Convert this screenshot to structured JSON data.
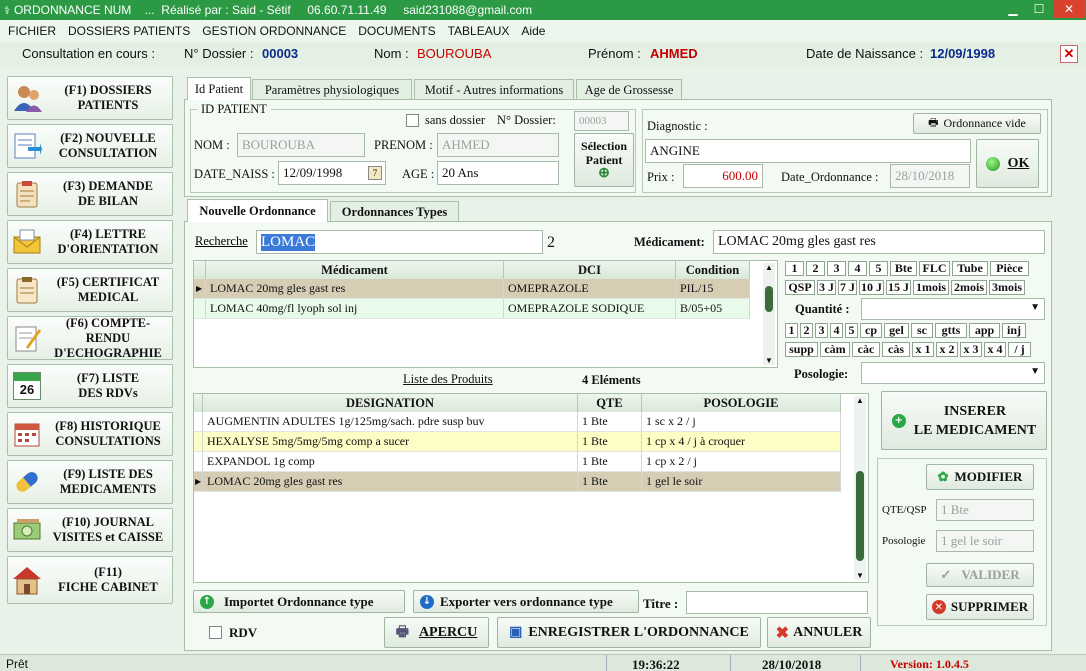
{
  "window": {
    "title": "ORDONNANCE NUM    ...  Réalisé par : Said - Sétif     06.60.71.11.49     said231088@gmail.com"
  },
  "menu": [
    "FICHIER",
    "DOSSIERS PATIENTS",
    "GESTION ORDONNANCE",
    "DOCUMENTS",
    "TABLEAUX",
    "Aide"
  ],
  "infobar": {
    "consultation_label": "Consultation en cours :",
    "dossier_label": "N° Dossier :",
    "dossier_value": "00003",
    "nom_label": "Nom :",
    "nom_value": "BOUROUBA",
    "prenom_label": "Prénom :",
    "prenom_value": "AHMED",
    "dob_label": "Date de Naissance :",
    "dob_value": "12/09/1998"
  },
  "nav": [
    {
      "label": "(F1)  DOSSIERS\nPATIENTS",
      "icon": "patients-icon"
    },
    {
      "label": "(F2)  NOUVELLE\nCONSULTATION",
      "icon": "new-consultation-icon"
    },
    {
      "label": "(F3)  DEMANDE\nDE BILAN",
      "icon": "clipboard-icon"
    },
    {
      "label": "(F4)  LETTRE\nD'ORIENTATION",
      "icon": "letter-icon"
    },
    {
      "label": "(F5) CERTIFICAT\nMEDICAL",
      "icon": "certificate-icon"
    },
    {
      "label": "(F6) COMPTE-RENDU\nD'ECHOGRAPHIE",
      "icon": "report-icon"
    },
    {
      "label": "(F7) LISTE\nDES RDVs",
      "icon": "calendar-icon"
    },
    {
      "label": "(F8)  HISTORIQUE\nCONSULTATIONS",
      "icon": "history-icon"
    },
    {
      "label": "(F9)  LISTE DES\nMEDICAMENTS",
      "icon": "pill-icon"
    },
    {
      "label": "(F10)  JOURNAL\nVISITES et CAISSE",
      "icon": "cash-icon"
    },
    {
      "label": "(F11)\nFICHE CABINET",
      "icon": "house-icon"
    }
  ],
  "calendar_day": "26",
  "tabs_top": [
    "Id Patient",
    "Paramètres physiologiques",
    "Motif - Autres informations",
    "Age de Grossesse"
  ],
  "patient": {
    "group_title": "ID PATIENT",
    "sans_dossier_label": "sans dossier",
    "dossier_label": "N° Dossier:",
    "dossier_value": "00003",
    "nom_label": "NOM :",
    "nom_value": "BOUROUBA",
    "prenom_label": "PRENOM :",
    "prenom_value": "AHMED",
    "date_label": "DATE_NAISS :",
    "date_value": "12/09/1998",
    "age_label": "AGE :",
    "age_value": "20 Ans",
    "select_btn": "Sélection\nPatient"
  },
  "diagnostic": {
    "label": "Diagnostic :",
    "value": "ANGINE",
    "ordonnance_vide": "Ordonnance vide",
    "prix_label": "Prix :",
    "prix_value": "600.00",
    "date_label": "Date_Ordonnance :",
    "date_value": "28/10/2018",
    "ok_btn": "OK"
  },
  "tabs_mid": [
    "Nouvelle Ordonnance",
    "Ordonnances Types"
  ],
  "search": {
    "label": "Recherche",
    "value": "LOMAC",
    "count": "2",
    "med_label": "Médicament:",
    "med_value": "LOMAC 20mg gles gast res"
  },
  "med_grid": {
    "headers": [
      "Médicament",
      "DCI",
      "Condition"
    ],
    "rows": [
      [
        "LOMAC 20mg gles gast res",
        "OMEPRAZOLE",
        "PIL/15"
      ],
      [
        "LOMAC 40mg/fl lyoph sol inj",
        "OMEPRAZOLE SODIQUE",
        "B/05+05"
      ]
    ]
  },
  "qty_chips_row1": [
    "1",
    "2",
    "3",
    "4",
    "5",
    "Bte",
    "FLC",
    "Tube",
    "Pièce"
  ],
  "qty_chips_row2": [
    "QSP",
    "3 J",
    "7 J",
    "10 J",
    "15 J",
    "1mois",
    "2mois",
    "3mois"
  ],
  "quantite_label": "Quantité :",
  "poso_chips_row1": [
    "1",
    "2",
    "3",
    "4",
    "5",
    "cp",
    "gel",
    "sc",
    "gtts",
    "app",
    "inj"
  ],
  "poso_chips_row2": [
    "supp",
    "càm",
    "càc",
    "càs",
    "x 1",
    "x 2",
    "x 3",
    "x 4",
    "/ j"
  ],
  "posologie_label": "Posologie:",
  "products": {
    "link": "Liste des Produits",
    "count": "4 Eléments",
    "headers": [
      "DESIGNATION",
      "QTE",
      "POSOLOGIE"
    ],
    "rows": [
      [
        "AUGMENTIN ADULTES 1g/125mg/sach. pdre susp buv",
        "1 Bte",
        "1 sc x 2 / j"
      ],
      [
        "HEXALYSE 5mg/5mg/5mg comp a sucer",
        "1 Bte",
        "1 cp x 4 / j à croquer"
      ],
      [
        "EXPANDOL 1g comp",
        "1 Bte",
        "1 cp x 2 / j"
      ],
      [
        "LOMAC 20mg gles gast res",
        "1 Bte",
        "1 gel le soir"
      ]
    ]
  },
  "right_actions": {
    "inserer": "INSERER\nLE MEDICAMENT",
    "modifier": "MODIFIER",
    "qte_label": "QTE/QSP",
    "qte_value": "1 Bte",
    "poso_label": "Posologie",
    "poso_value": "1 gel le soir",
    "valider": "VALIDER",
    "supprimer": "SUPPRIMER"
  },
  "bottom": {
    "import_btn": "Importet Ordonnance type",
    "export_btn": "Exporter vers ordonnance type",
    "titre_label": "Titre :",
    "rdv_label": "RDV",
    "apercu": "APERCU",
    "enregistrer": "ENREGISTRER L'ORDONNANCE",
    "annuler": "ANNULER"
  },
  "status": {
    "ready": "Prêt",
    "time": "19:36:22",
    "date": "28/10/2018",
    "version": "Version: 1.0.4.5"
  },
  "colors": {
    "title_green": "#2c9a44",
    "value_blue": "#0c2a8c",
    "value_red": "#c80000",
    "row_selected": "#d6cdb4",
    "row_alt": "#e8fbea",
    "row_yellow": "#fefdc6"
  }
}
